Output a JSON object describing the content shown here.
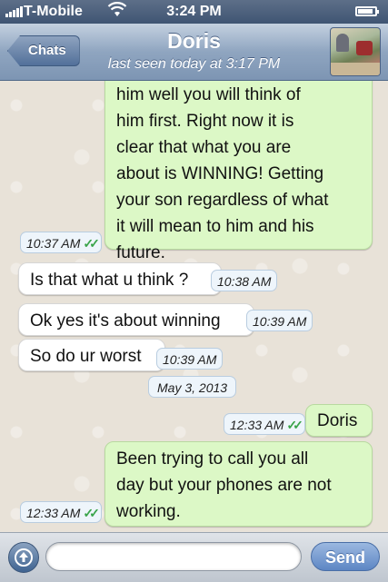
{
  "status_bar": {
    "carrier": "T-Mobile",
    "time": "3:24 PM",
    "wifi_icon": "wifi-icon",
    "battery_level": 0.9
  },
  "nav": {
    "back_label": "Chats",
    "contact_name": "Doris",
    "last_seen": "last seen today at 3:17 PM"
  },
  "messages": [
    {
      "direction": "outgoing",
      "lines": [
        "him well you will think of",
        "him first. Right now it is",
        "clear that what you are",
        "about is WINNING! Getting",
        "your son regardless of what",
        "it will mean to him and his",
        "future."
      ],
      "time": "10:37 AM",
      "status": "read"
    },
    {
      "direction": "incoming",
      "text": "Is that what u think ?",
      "time": "10:38 AM"
    },
    {
      "direction": "incoming",
      "text": "Ok yes it's about winning",
      "time": "10:39 AM"
    },
    {
      "direction": "incoming",
      "text": "So do ur worst",
      "time": "10:39 AM"
    },
    {
      "direction": "date",
      "text": "May 3, 2013"
    },
    {
      "direction": "outgoing",
      "text": "Doris",
      "time": "12:33 AM",
      "status": "read"
    },
    {
      "direction": "outgoing",
      "lines": [
        "Been trying to call you all",
        "day but your phones are not",
        "working."
      ],
      "time": "12:33 AM",
      "status": "read"
    }
  ],
  "composer": {
    "attach_icon": "upload-icon",
    "placeholder": "",
    "send_label": "Send"
  },
  "colors": {
    "outgoing_bubble": "#dcf8c6",
    "incoming_bubble": "#ffffff",
    "read_ticks": "#3aa44a",
    "nav_bar": "#8fa5c0"
  }
}
